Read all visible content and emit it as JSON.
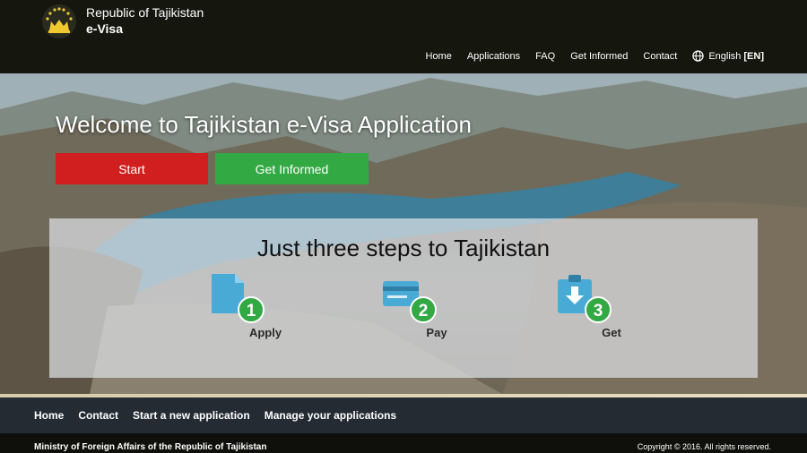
{
  "header": {
    "country": "Republic of Tajikistan",
    "product": "e-Visa",
    "nav": [
      "Home",
      "Applications",
      "FAQ",
      "Get Informed",
      "Contact"
    ],
    "language": "English",
    "language_code": "[EN]"
  },
  "hero": {
    "title": "Welcome to Tajikistan e-Visa Application",
    "start_button": "Start",
    "info_button": "Get Informed",
    "start_color": "#d11e1e",
    "info_color": "#33a943"
  },
  "steps": {
    "title": "Just three steps to Tajikistan",
    "items": [
      {
        "label": "Apply",
        "number": "1",
        "icon": "document-icon"
      },
      {
        "label": "Pay",
        "number": "2",
        "icon": "credit-card-icon"
      },
      {
        "label": "Get",
        "number": "3",
        "icon": "clipboard-download-icon"
      }
    ],
    "icon_color": "#4aaad6",
    "badge_color": "#33a943"
  },
  "footer": {
    "nav": [
      "Home",
      "Contact",
      "Start a new application",
      "Manage your applications"
    ],
    "ministry": "Ministry of Foreign Affairs of the Republic of Tajikistan",
    "copyright": "Copyright © 2016. All rights reserved."
  }
}
